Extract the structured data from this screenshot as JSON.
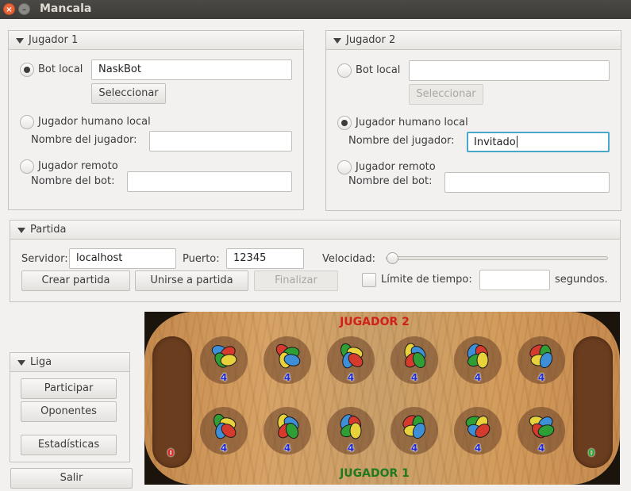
{
  "window": {
    "title": "Mancala",
    "close_glyph": "×",
    "minimize_glyph": "–"
  },
  "player1": {
    "header": "Jugador 1",
    "bot_local_label": "Bot local",
    "bot_local_value": "NaskBot",
    "select_button": "Seleccionar",
    "human_local_label": "Jugador humano local",
    "player_name_label": "Nombre del jugador:",
    "player_name_value": "",
    "remote_label": "Jugador remoto",
    "bot_name_label": "Nombre del bot:",
    "bot_name_value": "",
    "selected_mode": "bot_local"
  },
  "player2": {
    "header": "Jugador 2",
    "bot_local_label": "Bot local",
    "bot_local_value": "",
    "select_button": "Seleccionar",
    "human_local_label": "Jugador humano local",
    "player_name_label": "Nombre del jugador:",
    "player_name_value": "Invitado",
    "remote_label": "Jugador remoto",
    "bot_name_label": "Nombre del bot:",
    "bot_name_value": "",
    "selected_mode": "human_local"
  },
  "match": {
    "header": "Partida",
    "server_label": "Servidor:",
    "server_value": "localhost",
    "port_label": "Puerto:",
    "port_value": "12345",
    "speed_label": "Velocidad:",
    "speed_level": 0,
    "create_button": "Crear partida",
    "join_button": "Unirse a partida",
    "finish_button": "Finalizar",
    "time_limit_label": "Límite de tiempo:",
    "time_limit_value": "",
    "seconds_label": "segundos."
  },
  "league": {
    "header": "Liga",
    "participate_button": "Participar",
    "opponents_button": "Oponentes",
    "stats_button": "Estadísticas"
  },
  "exit_button": "Salir",
  "board": {
    "top_player_label": "JUGADOR 2",
    "bottom_player_label": "JUGADOR 1",
    "top_player_color": "#d0201c",
    "bottom_player_color": "#1f7a1f",
    "left_store_count": "0",
    "right_store_count": "0",
    "left_store_color": "#e01f1f",
    "right_store_color": "#1aaa2a",
    "top_pits": [
      "4",
      "4",
      "4",
      "4",
      "4",
      "4"
    ],
    "bottom_pits": [
      "4",
      "4",
      "4",
      "4",
      "4",
      "4"
    ],
    "seed_colors": [
      "#3f8fd6",
      "#d63a2c",
      "#2f9e35",
      "#e8d23c"
    ]
  }
}
